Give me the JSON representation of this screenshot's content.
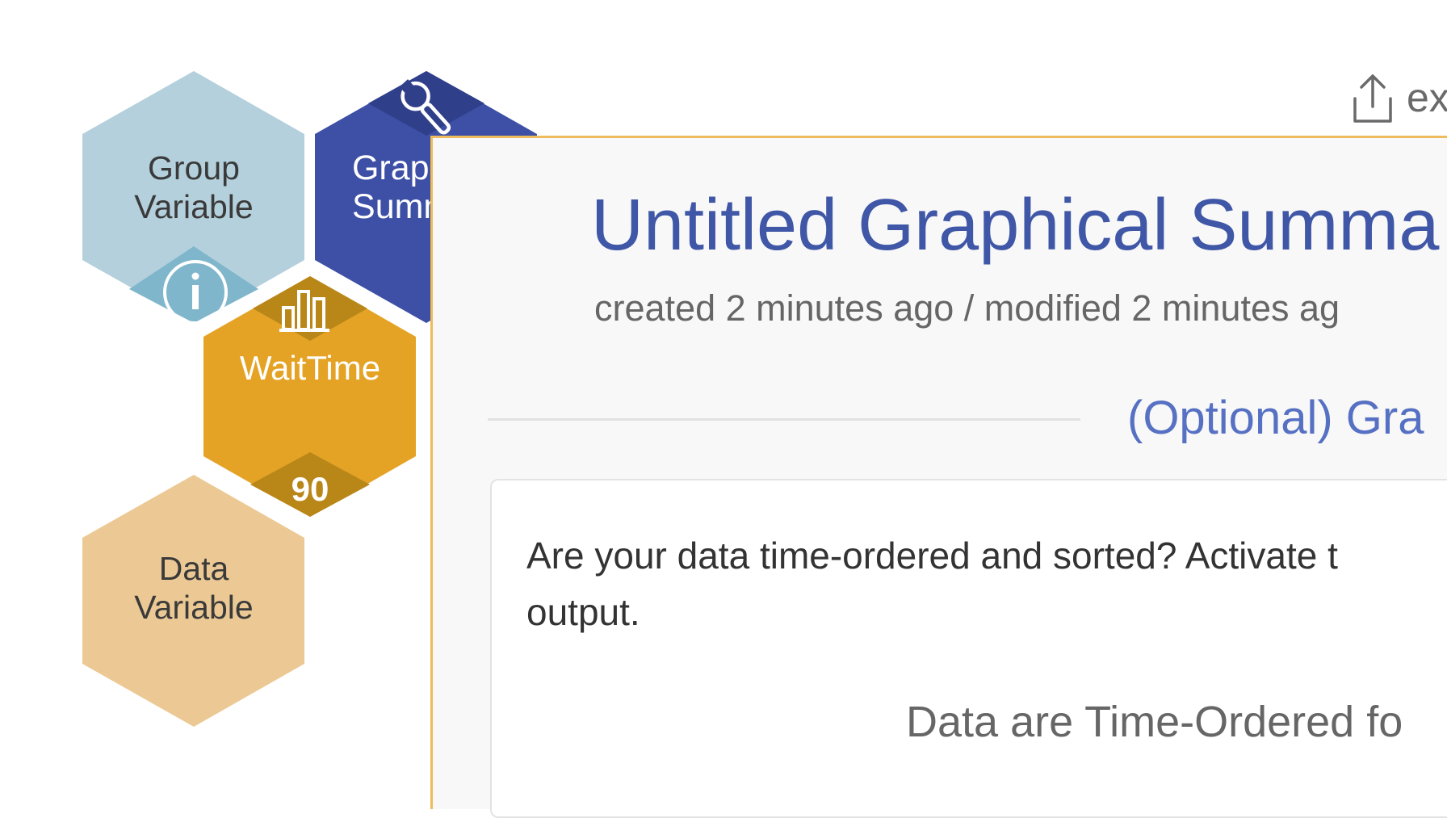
{
  "hex_nav": {
    "group_variable": {
      "line1": "Group",
      "line2": "Variable",
      "color": "#b4d0dc"
    },
    "graphical_summary": {
      "line1": "Graphical",
      "line2": "Summary",
      "color": "#3d50a6"
    },
    "wait_time": {
      "label": "WaitTime",
      "count": "90",
      "color": "#e4a325"
    },
    "data_variable": {
      "line1": "Data",
      "line2": "Variable",
      "color": "#ecc994"
    }
  },
  "toolbar": {
    "export_label": "ex"
  },
  "header": {
    "title": "Untitled Graphical Summa",
    "meta": "created 2 minutes ago / modified 2 minutes ag"
  },
  "section": {
    "title": "(Optional) Gra"
  },
  "card": {
    "text_line1": "Are your data time-ordered and sorted? Activate t",
    "text_line2": "output.",
    "toggle_label": "Data are Time-Ordered fo"
  },
  "colors": {
    "accent": "#eebc5c",
    "title": "#3f57a6",
    "link": "#5670c3"
  }
}
